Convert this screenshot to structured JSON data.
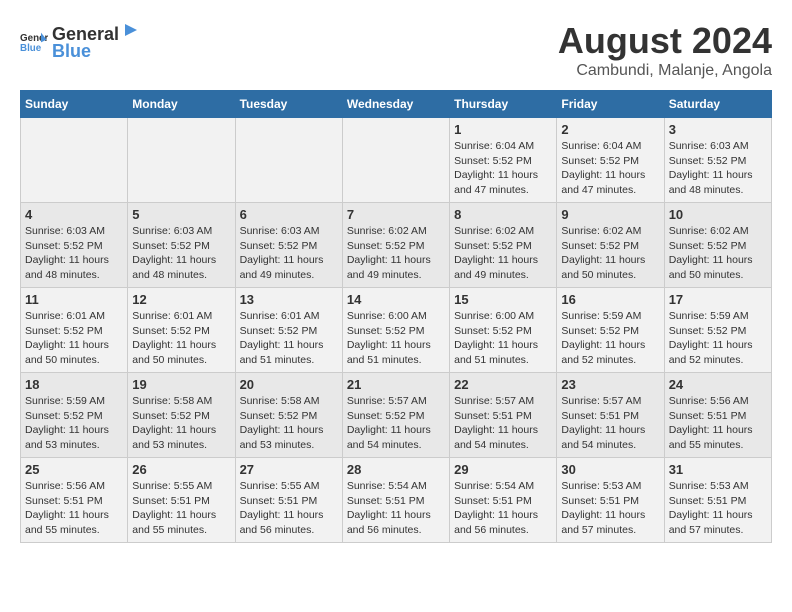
{
  "header": {
    "logo_general": "General",
    "logo_blue": "Blue",
    "title": "August 2024",
    "subtitle": "Cambundi, Malanje, Angola"
  },
  "calendar": {
    "days_of_week": [
      "Sunday",
      "Monday",
      "Tuesday",
      "Wednesday",
      "Thursday",
      "Friday",
      "Saturday"
    ],
    "weeks": [
      {
        "cells": [
          {
            "day": "",
            "info": ""
          },
          {
            "day": "",
            "info": ""
          },
          {
            "day": "",
            "info": ""
          },
          {
            "day": "",
            "info": ""
          },
          {
            "day": "1",
            "info": "Sunrise: 6:04 AM\nSunset: 5:52 PM\nDaylight: 11 hours\nand 47 minutes."
          },
          {
            "day": "2",
            "info": "Sunrise: 6:04 AM\nSunset: 5:52 PM\nDaylight: 11 hours\nand 47 minutes."
          },
          {
            "day": "3",
            "info": "Sunrise: 6:03 AM\nSunset: 5:52 PM\nDaylight: 11 hours\nand 48 minutes."
          }
        ]
      },
      {
        "cells": [
          {
            "day": "4",
            "info": "Sunrise: 6:03 AM\nSunset: 5:52 PM\nDaylight: 11 hours\nand 48 minutes."
          },
          {
            "day": "5",
            "info": "Sunrise: 6:03 AM\nSunset: 5:52 PM\nDaylight: 11 hours\nand 48 minutes."
          },
          {
            "day": "6",
            "info": "Sunrise: 6:03 AM\nSunset: 5:52 PM\nDaylight: 11 hours\nand 49 minutes."
          },
          {
            "day": "7",
            "info": "Sunrise: 6:02 AM\nSunset: 5:52 PM\nDaylight: 11 hours\nand 49 minutes."
          },
          {
            "day": "8",
            "info": "Sunrise: 6:02 AM\nSunset: 5:52 PM\nDaylight: 11 hours\nand 49 minutes."
          },
          {
            "day": "9",
            "info": "Sunrise: 6:02 AM\nSunset: 5:52 PM\nDaylight: 11 hours\nand 50 minutes."
          },
          {
            "day": "10",
            "info": "Sunrise: 6:02 AM\nSunset: 5:52 PM\nDaylight: 11 hours\nand 50 minutes."
          }
        ]
      },
      {
        "cells": [
          {
            "day": "11",
            "info": "Sunrise: 6:01 AM\nSunset: 5:52 PM\nDaylight: 11 hours\nand 50 minutes."
          },
          {
            "day": "12",
            "info": "Sunrise: 6:01 AM\nSunset: 5:52 PM\nDaylight: 11 hours\nand 50 minutes."
          },
          {
            "day": "13",
            "info": "Sunrise: 6:01 AM\nSunset: 5:52 PM\nDaylight: 11 hours\nand 51 minutes."
          },
          {
            "day": "14",
            "info": "Sunrise: 6:00 AM\nSunset: 5:52 PM\nDaylight: 11 hours\nand 51 minutes."
          },
          {
            "day": "15",
            "info": "Sunrise: 6:00 AM\nSunset: 5:52 PM\nDaylight: 11 hours\nand 51 minutes."
          },
          {
            "day": "16",
            "info": "Sunrise: 5:59 AM\nSunset: 5:52 PM\nDaylight: 11 hours\nand 52 minutes."
          },
          {
            "day": "17",
            "info": "Sunrise: 5:59 AM\nSunset: 5:52 PM\nDaylight: 11 hours\nand 52 minutes."
          }
        ]
      },
      {
        "cells": [
          {
            "day": "18",
            "info": "Sunrise: 5:59 AM\nSunset: 5:52 PM\nDaylight: 11 hours\nand 53 minutes."
          },
          {
            "day": "19",
            "info": "Sunrise: 5:58 AM\nSunset: 5:52 PM\nDaylight: 11 hours\nand 53 minutes."
          },
          {
            "day": "20",
            "info": "Sunrise: 5:58 AM\nSunset: 5:52 PM\nDaylight: 11 hours\nand 53 minutes."
          },
          {
            "day": "21",
            "info": "Sunrise: 5:57 AM\nSunset: 5:52 PM\nDaylight: 11 hours\nand 54 minutes."
          },
          {
            "day": "22",
            "info": "Sunrise: 5:57 AM\nSunset: 5:51 PM\nDaylight: 11 hours\nand 54 minutes."
          },
          {
            "day": "23",
            "info": "Sunrise: 5:57 AM\nSunset: 5:51 PM\nDaylight: 11 hours\nand 54 minutes."
          },
          {
            "day": "24",
            "info": "Sunrise: 5:56 AM\nSunset: 5:51 PM\nDaylight: 11 hours\nand 55 minutes."
          }
        ]
      },
      {
        "cells": [
          {
            "day": "25",
            "info": "Sunrise: 5:56 AM\nSunset: 5:51 PM\nDaylight: 11 hours\nand 55 minutes."
          },
          {
            "day": "26",
            "info": "Sunrise: 5:55 AM\nSunset: 5:51 PM\nDaylight: 11 hours\nand 55 minutes."
          },
          {
            "day": "27",
            "info": "Sunrise: 5:55 AM\nSunset: 5:51 PM\nDaylight: 11 hours\nand 56 minutes."
          },
          {
            "day": "28",
            "info": "Sunrise: 5:54 AM\nSunset: 5:51 PM\nDaylight: 11 hours\nand 56 minutes."
          },
          {
            "day": "29",
            "info": "Sunrise: 5:54 AM\nSunset: 5:51 PM\nDaylight: 11 hours\nand 56 minutes."
          },
          {
            "day": "30",
            "info": "Sunrise: 5:53 AM\nSunset: 5:51 PM\nDaylight: 11 hours\nand 57 minutes."
          },
          {
            "day": "31",
            "info": "Sunrise: 5:53 AM\nSunset: 5:51 PM\nDaylight: 11 hours\nand 57 minutes."
          }
        ]
      }
    ]
  }
}
